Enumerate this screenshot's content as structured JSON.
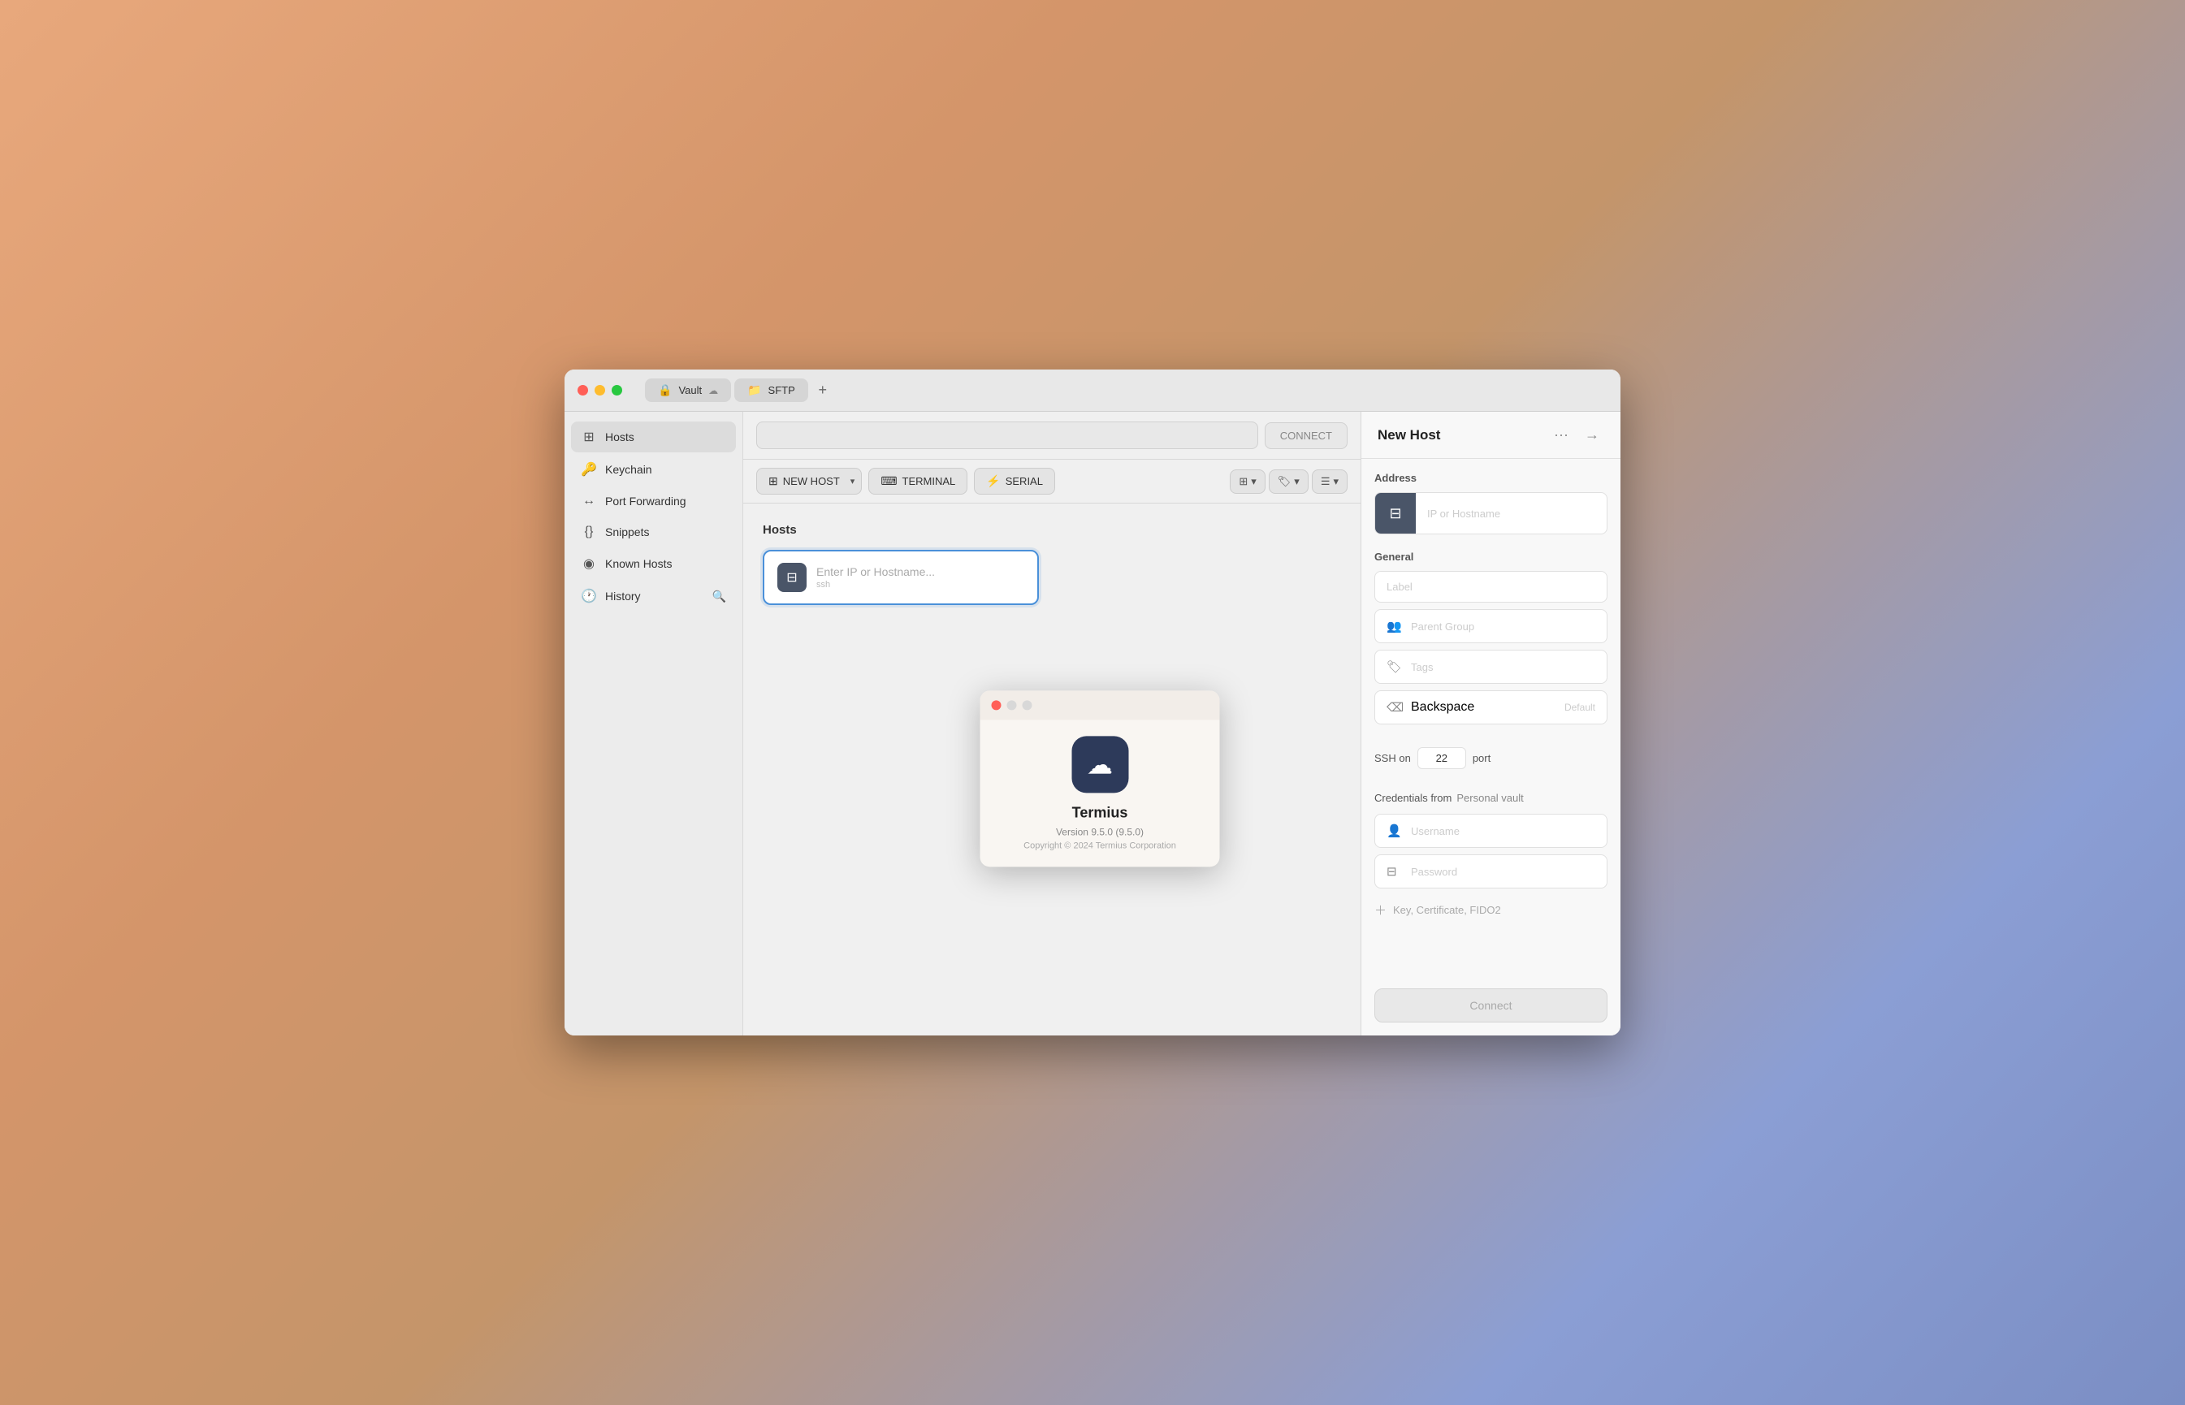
{
  "window": {
    "title": "Termius"
  },
  "titlebar": {
    "tabs": [
      {
        "id": "vault",
        "icon": "🔒",
        "label": "Vault",
        "cloud": true
      },
      {
        "id": "sftp",
        "icon": "📁",
        "label": "SFTP"
      }
    ],
    "add_tab_label": "+"
  },
  "sidebar": {
    "items": [
      {
        "id": "hosts",
        "icon": "⊞",
        "label": "Hosts",
        "active": true
      },
      {
        "id": "keychain",
        "icon": "🔑",
        "label": "Keychain",
        "active": false
      },
      {
        "id": "port-forwarding",
        "icon": "↔",
        "label": "Port Forwarding",
        "active": false
      },
      {
        "id": "snippets",
        "icon": "{}",
        "label": "Snippets",
        "active": false
      },
      {
        "id": "known-hosts",
        "icon": "◉",
        "label": "Known Hosts",
        "active": false
      },
      {
        "id": "history",
        "icon": "🕐",
        "label": "History",
        "active": false
      }
    ],
    "search_tooltip": "Search"
  },
  "toolbar": {
    "connect_label": "CONNECT",
    "new_host_label": "NEW HOST",
    "terminal_label": "TERMINAL",
    "serial_label": "SERIAL"
  },
  "main": {
    "section_title": "Hosts",
    "host_input": {
      "placeholder": "Enter IP or Hostname...",
      "sub_label": "ssh"
    }
  },
  "about_dialog": {
    "app_name": "Termius",
    "version": "Version 9.5.0 (9.5.0)",
    "copyright": "Copyright © 2024 Termius Corporation"
  },
  "right_panel": {
    "title": "New Host",
    "more_label": "···",
    "enter_label": "→",
    "address": {
      "section_title": "Address",
      "placeholder": "IP or Hostname"
    },
    "general": {
      "section_title": "General",
      "label_placeholder": "Label",
      "parent_group_placeholder": "Parent Group",
      "tags_placeholder": "Tags",
      "backspace_label": "Backspace",
      "backspace_default": "Default"
    },
    "ssh": {
      "label": "SSH on",
      "port_value": "22",
      "port_label": "port"
    },
    "credentials": {
      "label": "Credentials from",
      "value": "Personal vault",
      "username_placeholder": "Username",
      "password_placeholder": "Password",
      "key_label": "Key, Certificate, FIDO2"
    },
    "connect_label": "Connect"
  }
}
